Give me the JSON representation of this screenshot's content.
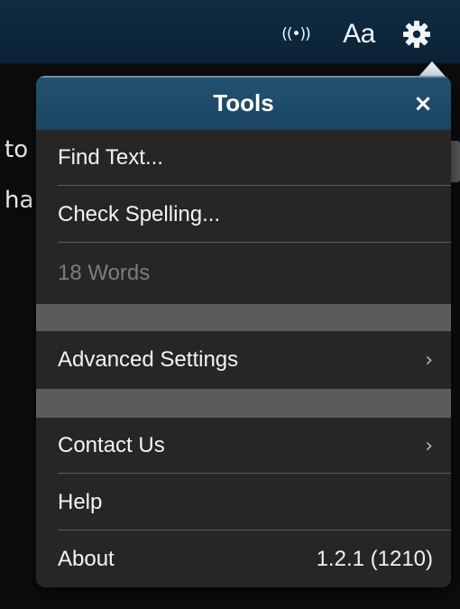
{
  "toolbar": {
    "broadcast_glyph": "((•))",
    "font_label": "Aa",
    "icons": {
      "broadcast": "broadcast-icon",
      "font": "font-size-icon",
      "settings": "gear-icon"
    }
  },
  "document": {
    "line1": "to",
    "line2": "ha"
  },
  "popover": {
    "title": "Tools",
    "close_label": "×",
    "items": [
      {
        "label": "Find Text..."
      },
      {
        "label": "Check Spelling..."
      },
      {
        "label": "18 Words"
      },
      {
        "label": "Advanced Settings",
        "chevron": "›"
      },
      {
        "label": "Contact Us",
        "chevron": "›"
      },
      {
        "label": "Help"
      },
      {
        "label": "About",
        "value": "1.2.1 (1210)"
      }
    ]
  },
  "colors": {
    "toolbar_bg": "#0f2c43",
    "header_bg": "#225270",
    "menu_bg": "#262626",
    "separator": "#5b5b5b",
    "disabled_text": "#7d7d7d"
  }
}
